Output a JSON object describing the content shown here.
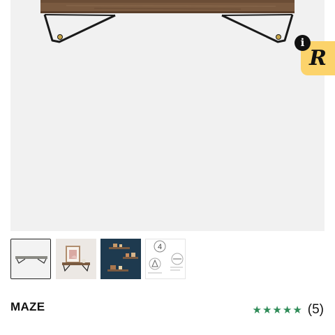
{
  "product": {
    "brand": "MAZE",
    "rating": 5,
    "review_count": "(5)"
  },
  "main_image": {
    "subject": "wood wall shelf with black metal brackets"
  },
  "thumbnails": [
    {
      "subject": "shelf front view",
      "selected": true
    },
    {
      "subject": "shelf with picture frame"
    },
    {
      "subject": "three shelves on blue wall"
    },
    {
      "subject": "installation instructions",
      "step_number": "4"
    }
  ],
  "badge": {
    "info_glyph": "i",
    "letter": "R",
    "color": "#fcd36b"
  },
  "colors": {
    "star": "#2e8b57",
    "image_bg": "#f1f1f1",
    "wood": "#7a5a40"
  }
}
